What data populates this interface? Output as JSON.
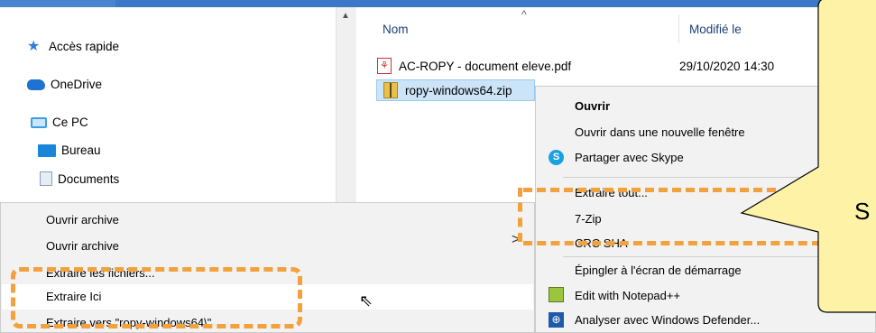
{
  "nav": {
    "items": [
      {
        "label": "Accès rapide",
        "icon": "star-icon"
      },
      {
        "label": "OneDrive",
        "icon": "cloud-icon"
      },
      {
        "label": "Ce PC",
        "icon": "computer-icon"
      },
      {
        "label": "Bureau",
        "icon": "desktop-folder-icon"
      },
      {
        "label": "Documents",
        "icon": "documents-folder-icon"
      }
    ]
  },
  "file_list": {
    "columns": [
      "Nom",
      "Modifié le"
    ],
    "files": [
      {
        "name": "AC-ROPY - document eleve.pdf",
        "modified": "29/10/2020 14:30",
        "icon": "pdf-icon"
      },
      {
        "name": "ropy-windows64.zip",
        "modified": "",
        "icon": "zip-icon",
        "selected": true
      }
    ]
  },
  "context_menu": {
    "items": [
      {
        "label": "Ouvrir",
        "bold": true
      },
      {
        "label": "Ouvrir dans une nouvelle fenêtre"
      },
      {
        "label": "Partager avec Skype",
        "icon": "skype-icon"
      },
      {
        "label": "Extraire tout..."
      },
      {
        "label": "7-Zip"
      },
      {
        "label": "CRC SHA"
      },
      {
        "label": "Épingler à l'écran de démarrage"
      },
      {
        "label": "Edit with Notepad++",
        "icon": "notepadpp-icon"
      },
      {
        "label": "Analyser avec Windows Defender...",
        "icon": "defender-icon"
      }
    ]
  },
  "submenu_7zip": {
    "items": [
      {
        "label": "Ouvrir archive"
      },
      {
        "label": "Ouvrir archive"
      },
      {
        "label": "Extraire les fichiers..."
      },
      {
        "label": "Extraire Ici",
        "hovered": true
      },
      {
        "label": "Extraire vers \"ropy-windows64\\\""
      }
    ]
  },
  "callout": {
    "text": "S"
  },
  "colors": {
    "highlight": "#f2a13d",
    "selection": "#cce4f7",
    "callout_fill": "#fdf2a6"
  }
}
